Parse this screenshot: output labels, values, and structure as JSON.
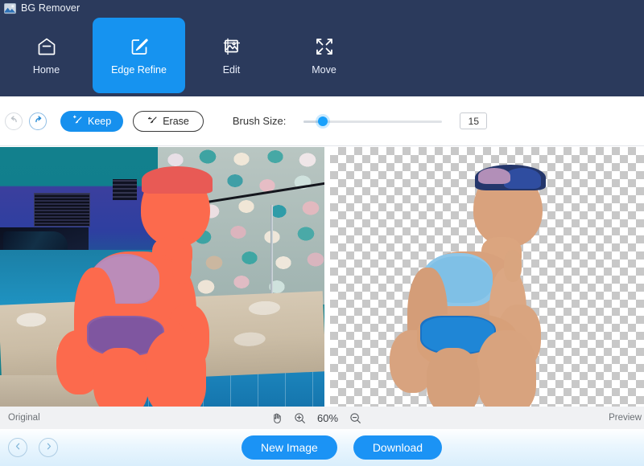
{
  "window": {
    "title": "BG Remover",
    "icon": "image-photo-icon"
  },
  "nav": {
    "tabs": [
      {
        "label": "Home",
        "icon": "home-icon",
        "active": false
      },
      {
        "label": "Edge Refine",
        "icon": "edge-refine-icon",
        "active": true
      },
      {
        "label": "Edit",
        "icon": "edit-image-icon",
        "active": false
      },
      {
        "label": "Move",
        "icon": "move-arrows-icon",
        "active": false
      }
    ]
  },
  "toolbar": {
    "undo_icon": "undo-arrow-icon",
    "redo_icon": "redo-arrow-icon",
    "keep_label": "Keep",
    "keep_icon": "keep-brush-icon",
    "erase_label": "Erase",
    "erase_icon": "erase-brush-icon",
    "brush_size_label": "Brush Size:",
    "brush_size_value": "15",
    "brush_size_min": 1,
    "brush_size_max": 100,
    "brush_size_percent": 14
  },
  "canvas": {
    "left_panel": {
      "label": "Original",
      "description": "Original photo of a toddler in a blue swimsuit sitting on a pool ledge, with the subject covered by a red keep-mask overlay"
    },
    "right_panel": {
      "label": "Preview",
      "description": "Background-removed cutout of the toddler over a transparency checkerboard"
    }
  },
  "statusbar": {
    "left_label": "Original",
    "right_label": "Preview",
    "pan_icon": "hand-pan-icon",
    "zoom_in_icon": "zoom-in-icon",
    "zoom_out_icon": "zoom-out-icon",
    "zoom_level": "60%"
  },
  "actionbar": {
    "prev_icon": "chevron-left-icon",
    "next_icon": "chevron-right-icon",
    "new_image_label": "New Image",
    "download_label": "Download"
  },
  "colors": {
    "header_bg": "#2b3a5c",
    "accent_blue": "#1690ee",
    "active_tab": "#1693f0",
    "mask_red": "#fc6a4d",
    "statusbar_bg": "#f0f1f3"
  }
}
